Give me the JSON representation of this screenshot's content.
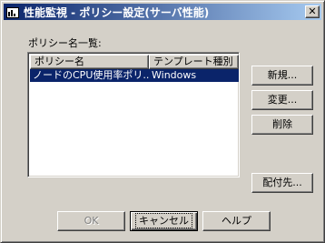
{
  "window": {
    "title": "性能監視 - ポリシー設定(サーバ性能)",
    "app_icon": "performance-chart-icon",
    "close_glyph": "✕"
  },
  "policy_list": {
    "label": "ポリシー名一覧:",
    "columns": [
      "ポリシー名",
      "テンプレート種別"
    ],
    "rows": [
      {
        "name": "ノードのCPU使用率ポリ...",
        "template": "Windows",
        "selected": true
      }
    ]
  },
  "side_buttons": {
    "new_label": "新規...",
    "edit_label": "変更...",
    "delete_label": "削除",
    "deploy_label": "配付先..."
  },
  "bottom_buttons": {
    "ok_label": "OK",
    "cancel_label": "キャンセル",
    "help_label": "ヘルプ"
  },
  "colors": {
    "face": "#d4d0c8",
    "title_start": "#0a246a",
    "title_end": "#a6caf0",
    "selection": "#0a246a"
  }
}
